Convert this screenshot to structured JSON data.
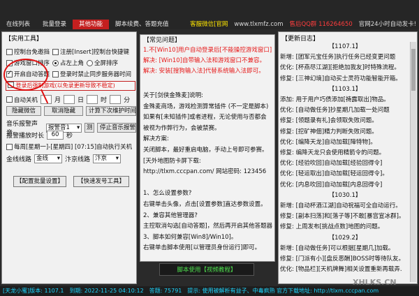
{
  "tabs": [
    {
      "label": "在线列表",
      "active": false
    },
    {
      "label": "批量登录",
      "active": false
    },
    {
      "label": "其他功能",
      "active": true
    },
    {
      "label": "脚本续费、答题充值",
      "active": false
    }
  ],
  "topinfo": {
    "wechat": "客服微信[官网",
    "site": "www.tlxmfz.com",
    "qq": "售后QQ群 116264650",
    "online": "官网24小时自动发卡!"
  },
  "tools": {
    "title": "【实用工具】",
    "ctrl_bind": "控制台免邀挡",
    "hotkey": "注册[Insert]控制台快捷键",
    "window_sort": "游戏窗口排序",
    "top_left": "占左上角",
    "fullscreen": "全屏排序",
    "auto_answer": "开启自动答题",
    "sync_server": "登录时禁止同步服务器时间",
    "warning": "登录后强制游戏(以免录更新导致不稳定)",
    "auto_off": "自动关机",
    "month": "月",
    "day": "日",
    "hour": "时",
    "minute": "分",
    "hide_wechat": "隐藏微信",
    "cancel_hide": "取消隐藏",
    "calc_quit": "计算下次维护时间",
    "music_label": "音乐报警声音",
    "music_value": "报警音1",
    "test_btn": "测",
    "stop_alarm": "停止音乐报警",
    "alarm_duration": "报警播放时长",
    "alarm_seconds": "60",
    "seconds": "秒",
    "weekly_label": "每周[星期一]-[星期四] [07:15]自动执行关机",
    "line_label": "金线线路",
    "line_value": "金线",
    "route_label": "汴京线路",
    "route_value": "汴京",
    "batch_btn": "【配置批量设置】",
    "quick_btn": "【快速发号工具】"
  },
  "notice": {
    "title": "【常见问题】",
    "line1": "1.不[Win10]用户自动登录后[不能操控游戏窗口]",
    "line2": "解决: [Win10]自带输入法和游戏窗口不兼容。",
    "line3": "解决: 安装[搜狗输入法]代替系统输入法即可。",
    "help": [
      "关于[剑侠金殊麦]说明:",
      "金殊麦商场，游戏检测算常插件 (不一定是脚本)",
      "如果有[未知插件]或者进程，无论使用与否都会",
      "被视为作弊行为，会被禁赛。",
      "解决方案:",
      "关闭脚本，最好重启电脑，手动上号即可参赛。",
      "[天外地图防卡屏下载:",
      "http://tlxm.cccpan.com/  网站密码: 123456",
      "",
      "1、怎么设置参数?",
      "右键单击头像，点击[设置参数]直达参数设置。",
      "2、兼容其他管理器?",
      "主控取消勾选[自动答题]，然后再开启其他答题器",
      "3、脚本如何兼容[Win8]/Win10]。",
      "右键单击脚本使用[以管理员身份运行]即可。"
    ],
    "video_btn": "脚本使用【视频教程】"
  },
  "log": {
    "title": "【更新日志】",
    "entries": [
      "【1107.1】",
      "新增: [团军元宝任务]执行任务已经变更问题",
      "优化: [杯燕尽江湖][拒绝加我友]时特殊流程。",
      "修复: [三神幻境]自动买士灵符功能智能开箱。",
      "【1103.1】",
      "添加: 用于用户巧债添加[祷露取出]物品。",
      "优化: [自动做任务]抄星期几加载一处问题",
      "修复: [领题录有礼]会领取失败问题。",
      "修复: [挖矿神佃]精力判断失败问题。",
      "优化: [编降天龙]自动加载[障特物]。",
      "修复: 编降天龙只会使用精箭令的问题。",
      "优化: [经验吹回]自动加载[经验回得令]",
      "优化: [轻运取出]自动加载[轻运回得令]。",
      "优化: [内息吹回]自动加载[内息回得令]",
      "【1030.1】",
      "新增: [自动杯酒江湖]自动祝福可全自动运行。",
      "修复: [副本扫荡]和[落子等]不敢[暴宫宣冰群]。",
      "修复: 上周发布[挑战点数]地图的问题。",
      "【1029.2】",
      "新增: [自动做任务]可以根据[星期几]加载。",
      "修复: [门派有小][盘反恶酬]BOSS时等待队友。",
      "优化: [物品栏][天机牌舞]相关设置重新再载弄."
    ]
  },
  "status": {
    "version": "[天龙小蜜]版本: 1107.1",
    "time": "到期: 2022-11-25 04:10:12",
    "score": "答题: 75791",
    "tip": "提示: 使用被解析有益子、中毒疯熟 官方下载地址: http://tlxm.cccpan.com"
  },
  "watermark": "XHLKS.CN"
}
